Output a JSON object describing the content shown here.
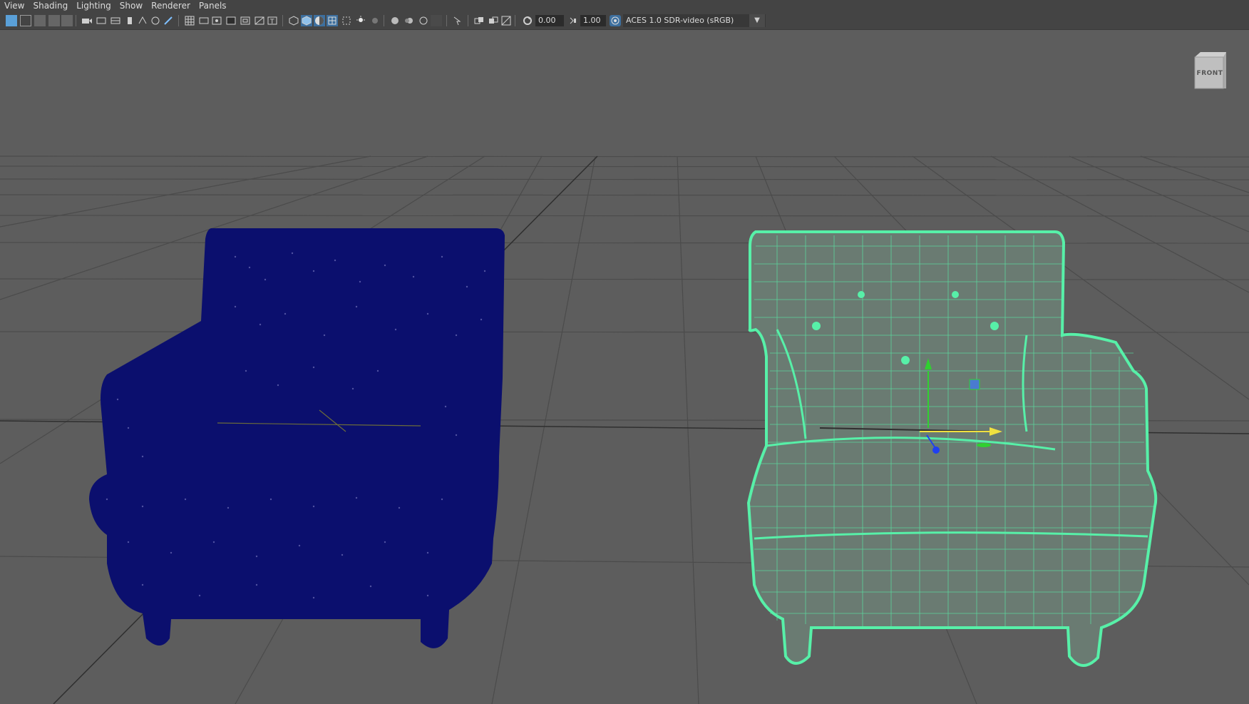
{
  "menubar": {
    "items": [
      "View",
      "Shading",
      "Lighting",
      "Show",
      "Renderer",
      "Panels"
    ]
  },
  "toolbar": {
    "exposure_value": "0.00",
    "gamma_value": "1.00",
    "color_space": "ACES 1.0 SDR-video (sRGB)"
  },
  "viewcube": {
    "label": "FRONT"
  },
  "colors": {
    "background": "#5d5d5d",
    "grid_line": "#4a4a4a",
    "point_cloud_chair": "#0b0f6e",
    "wireframe_chair": "#57f0a8",
    "axis_x": "#f0e040",
    "axis_y": "#30d030",
    "axis_z": "#2040f0"
  }
}
